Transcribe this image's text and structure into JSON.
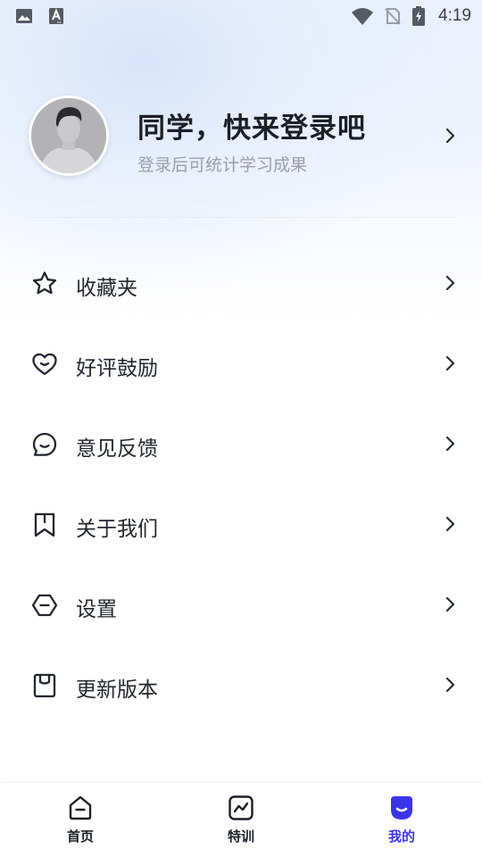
{
  "status_bar": {
    "time": "4:19",
    "icons": [
      "image-icon",
      "text-a-icon",
      "wifi-icon",
      "no-sim-icon",
      "battery-charging-icon"
    ]
  },
  "profile": {
    "title": "同学，快来登录吧",
    "subtitle": "登录后可统计学习成果"
  },
  "menu": [
    {
      "label": "收藏夹",
      "icon": "star-icon"
    },
    {
      "label": "好评鼓励",
      "icon": "heart-icon"
    },
    {
      "label": "意见反馈",
      "icon": "chat-bubble-icon"
    },
    {
      "label": "关于我们",
      "icon": "bookmark-icon"
    },
    {
      "label": "设置",
      "icon": "hexagon-settings-icon"
    },
    {
      "label": "更新版本",
      "icon": "box-icon"
    }
  ],
  "bottom_nav": [
    {
      "label": "首页",
      "icon": "home-icon",
      "active": false
    },
    {
      "label": "特训",
      "icon": "trend-icon",
      "active": false
    },
    {
      "label": "我的",
      "icon": "profile-smile-icon",
      "active": true
    }
  ],
  "colors": {
    "accent": "#3b35e8",
    "text": "#23262e",
    "subtext": "#9a9ea8"
  }
}
